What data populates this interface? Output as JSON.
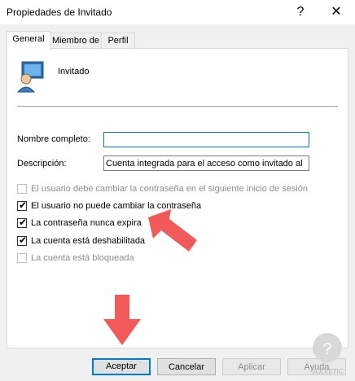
{
  "window": {
    "title": "Propiedades de Invitado",
    "help_glyph": "?",
    "close_glyph": "✕"
  },
  "tabs": [
    {
      "label": "General"
    },
    {
      "label": "Miembro de"
    },
    {
      "label": "Perfil"
    }
  ],
  "user": {
    "name": "Invitado"
  },
  "fields": {
    "full_name": {
      "label": "Nombre completo:",
      "value": ""
    },
    "description": {
      "label": "Descripción:",
      "value": "Cuenta integrada para el acceso como invitado al"
    }
  },
  "options": [
    {
      "label": "El usuario debe cambiar la contraseña en el siguiente inicio de sesión",
      "checked": false,
      "enabled": false
    },
    {
      "label": "El usuario no puede cambiar la contraseña",
      "checked": true,
      "enabled": true
    },
    {
      "label": "La contraseña nunca expira",
      "checked": true,
      "enabled": true
    },
    {
      "label": "La cuenta está deshabilitada",
      "checked": true,
      "enabled": true
    },
    {
      "label": "La cuenta está bloqueada",
      "checked": false,
      "enabled": false
    }
  ],
  "checkmark": "✔",
  "buttons": {
    "accept": "Aceptar",
    "cancel": "Cancelar",
    "apply": "Aplicar",
    "help": "Ayuda"
  },
  "colors": {
    "arrow": "#f25a5a",
    "focus_border": "#0078d7"
  }
}
